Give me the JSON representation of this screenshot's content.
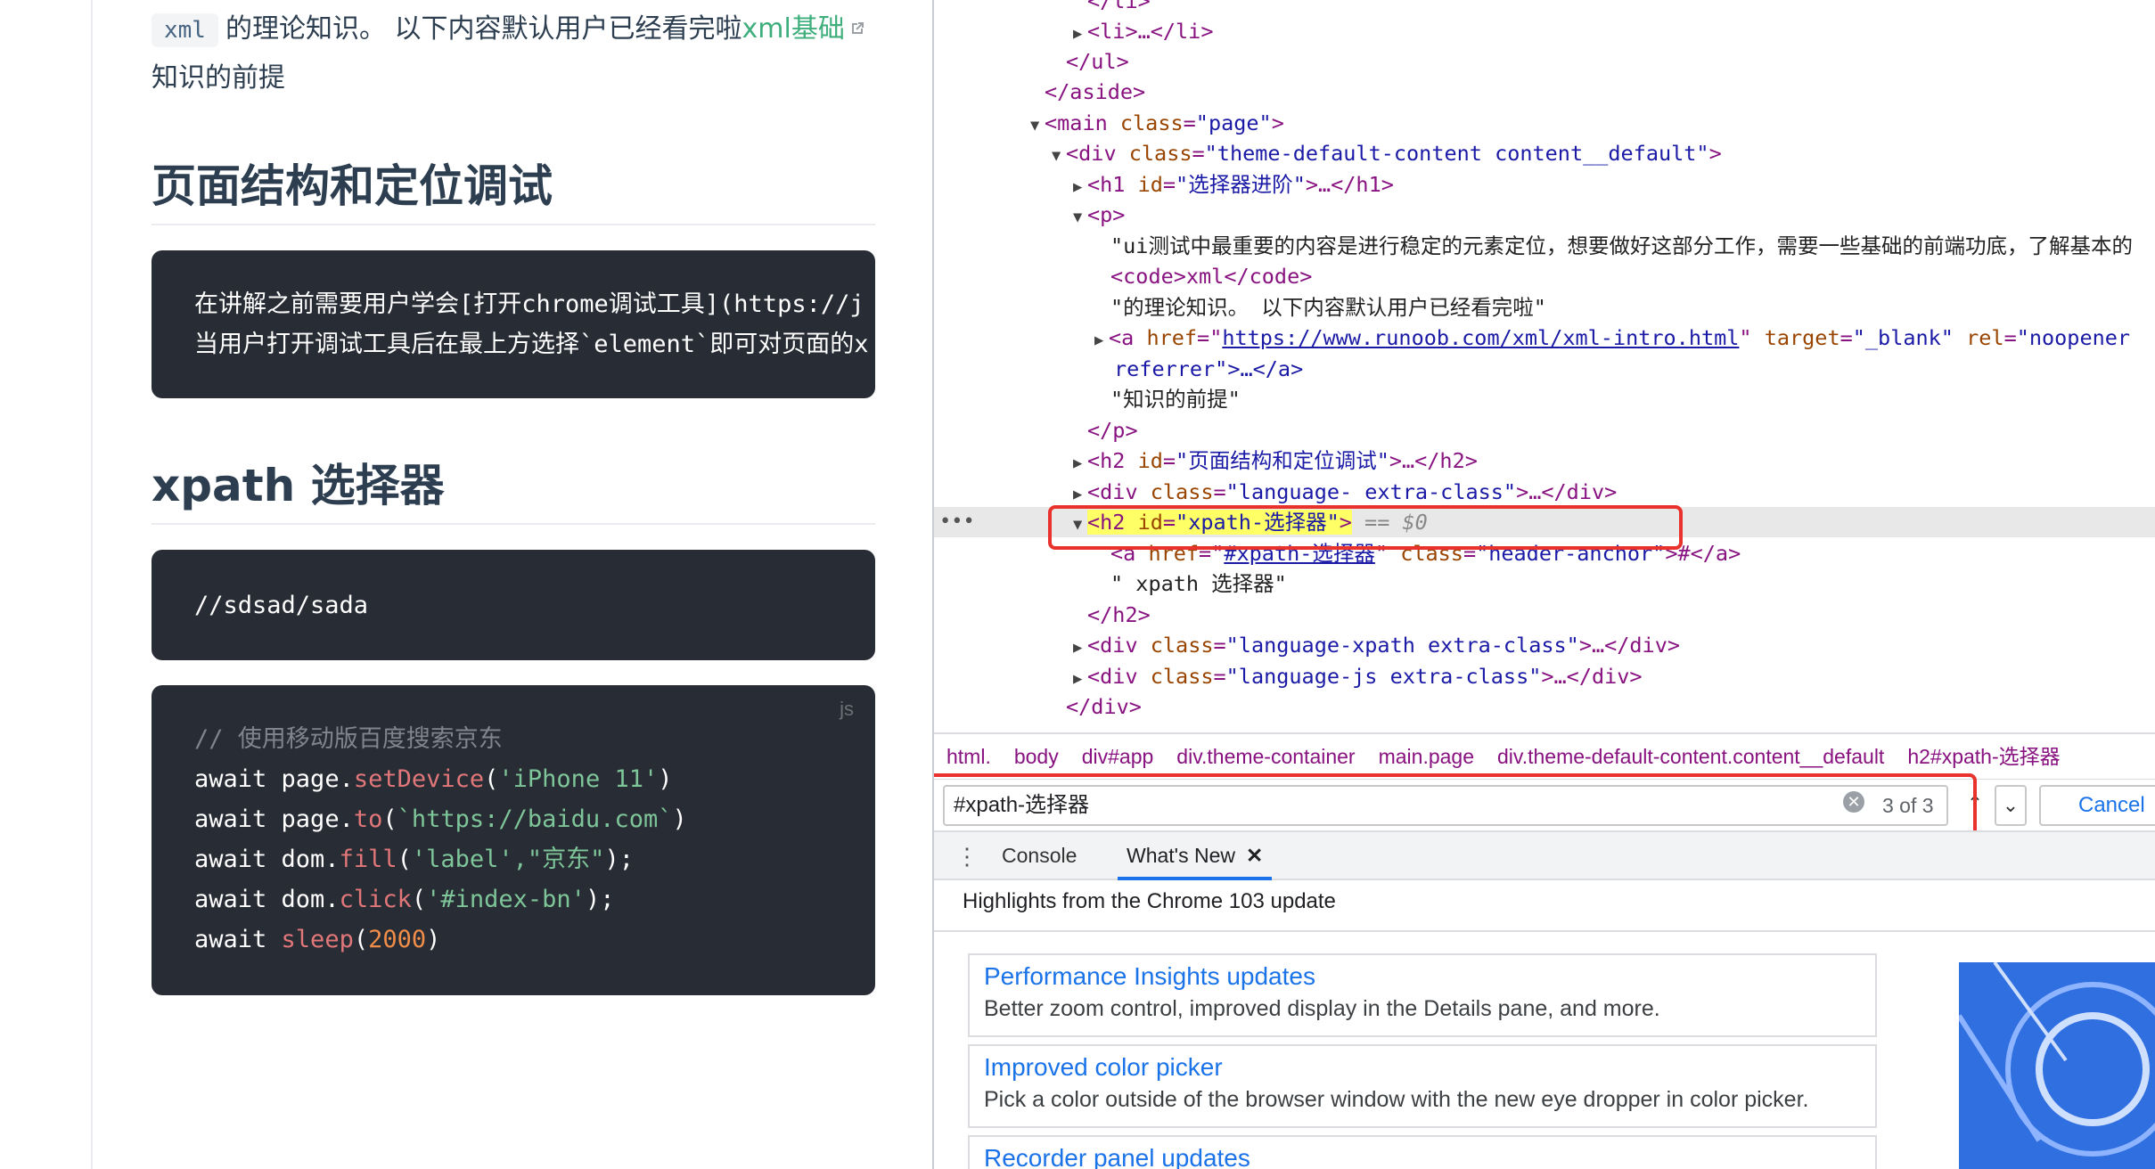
{
  "doc": {
    "intro": {
      "inline_code": "xml",
      "text1": "的理论知识。 以下内容默认用户已经看完啦",
      "link": "xml基础",
      "text2": "知识的前提"
    },
    "section1": {
      "heading": "页面结构和定位调试",
      "code_lines": [
        "在讲解之前需要用户学会[打开chrome调试工具](https://j",
        "当用户打开调试工具后在最上方选择`element`即可对页面的x"
      ]
    },
    "section2": {
      "heading": "xpath 选择器",
      "code_line": "//sdsad/sada"
    },
    "js_block": {
      "lang": "js",
      "comment": "// 使用移动版百度搜索京东",
      "lines": [
        {
          "kw": "await",
          "obj": "page.",
          "fn": "setDevice",
          "open": "(",
          "arg": "'iPhone 11'",
          "close": ")"
        },
        {
          "kw": "await",
          "obj": "page.",
          "fn": "to",
          "open": "(",
          "arg": "`https://baidu.com`",
          "close": ")"
        },
        {
          "kw": "await",
          "obj": "dom.",
          "fn": "fill",
          "open": "(",
          "arg": "'label',\"京东\"",
          "close": ");"
        },
        {
          "kw": "await",
          "obj": "dom.",
          "fn": "click",
          "open": "(",
          "arg": "'#index-bn'",
          "close": ");"
        },
        {
          "kw": "await",
          "obj": "",
          "fn": "sleep",
          "open": "(",
          "arg": "2000",
          "close": ")"
        }
      ]
    }
  },
  "devtools": {
    "dom": {
      "l0": "</li>",
      "l1_tag": "<li>…</li>",
      "l2": "</ul>",
      "l3": "</aside>",
      "l4_open": "<main ",
      "l4_attr": "class",
      "l4_val": "\"page\"",
      "l5_open": "<div ",
      "l5_attr": "class",
      "l5_val": "\"theme-default-content content__default\"",
      "l6_open": "<h1 ",
      "l6_attr": "id",
      "l6_val": "\"选择器进阶\"",
      "l6_close": ">…</h1>",
      "l7": "<p>",
      "l8": "\"ui测试中最重要的内容是进行稳定的元素定位，想要做好这部分工作，需要一些基础的前端功底，了解基本的",
      "l9": "<code>xml</code>",
      "l10": "\"的理论知识。 以下内容默认用户已经看完啦\"",
      "l11_open": "<a ",
      "l11_attr1": "href",
      "l11_link": "https://www.runoob.com/xml/xml-intro.html",
      "l11_attr2": "target",
      "l11_val2": "\"_blank\"",
      "l11_attr3": "rel",
      "l11_val3": "\"noopener",
      "l12": "referrer\">…</a>",
      "l13": "\"知识的前提\"",
      "l14": "</p>",
      "l15_open": "<h2 ",
      "l15_attr": "id",
      "l15_val": "\"页面结构和定位调试\"",
      "l15_close": ">…</h2>",
      "l16_open": "<div ",
      "l16_attr": "class",
      "l16_val": "\"language- extra-class\"",
      "l16_close": ">…</div>",
      "l17_open": "<h2 ",
      "l17_attr": "id",
      "l17_val": "\"xpath-选择器\"",
      "l17_suffix": "== $0",
      "l18_open": "<a ",
      "l18_attr1": "href",
      "l18_link": "#xpath-选择器",
      "l18_attr2": "class",
      "l18_val2": "\"header-anchor\"",
      "l18_close": ">#</a>",
      "l19": "\" xpath 选择器\"",
      "l20": "</h2>",
      "l21_open": "<div ",
      "l21_attr": "class",
      "l21_val": "\"language-xpath extra-class\"",
      "l21_close": ">…</div>",
      "l22_open": "<div ",
      "l22_attr": "class",
      "l22_val": "\"language-js extra-class\"",
      "l22_close": ">…</div>",
      "l23": "</div>"
    },
    "breadcrumbs": [
      "html.",
      "body",
      "div#app",
      "div.theme-container",
      "main.page",
      "div.theme-default-content.content__default",
      "h2#xpath-选择器"
    ],
    "search": {
      "query": "#xpath-选择器",
      "count": "3 of 3",
      "cancel": "Cancel"
    },
    "drawer": {
      "tabs": [
        "Console",
        "What's New"
      ],
      "header": "Highlights from the Chrome 103 update",
      "cards": [
        {
          "title": "Performance Insights updates",
          "desc": "Better zoom control, improved display in the Details pane, and more."
        },
        {
          "title": "Improved color picker",
          "desc": "Pick a color outside of the browser window with the new eye dropper in color picker."
        },
        {
          "title": "Recorder panel updates",
          "desc": ""
        }
      ]
    }
  },
  "colors": {
    "accent": "#1a73e8",
    "highlight_box": "#e8322b",
    "link_green": "#3eaf7c",
    "code_bg": "#282c34"
  }
}
